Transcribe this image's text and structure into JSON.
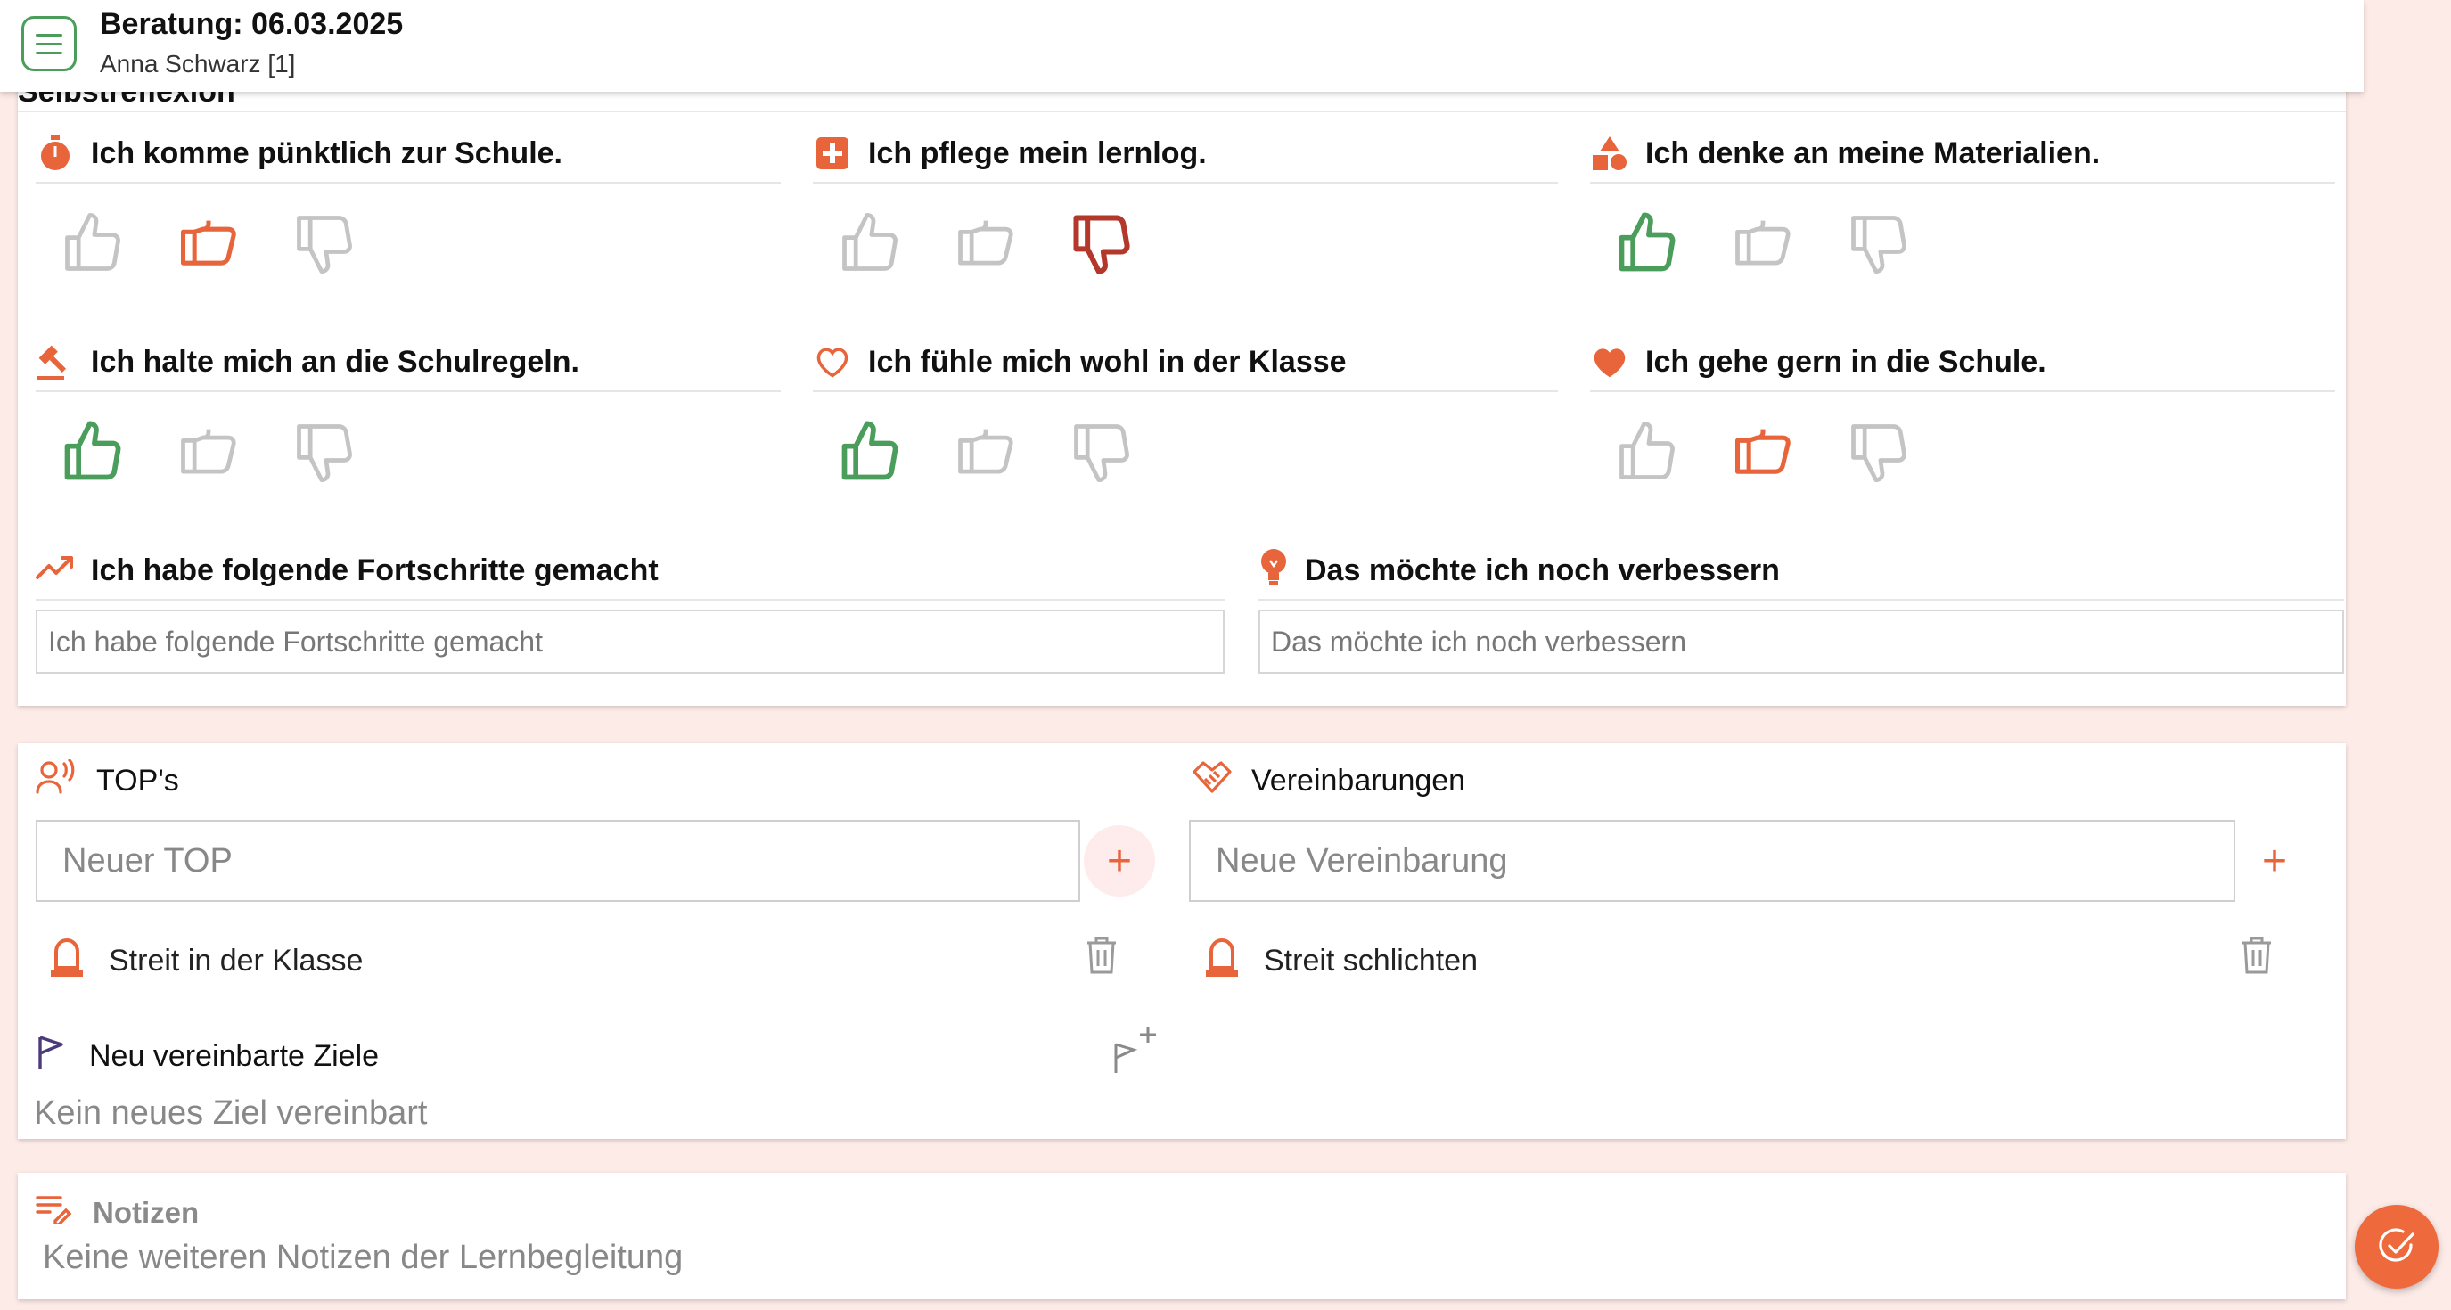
{
  "header": {
    "title": "Beratung: 06.03.2025",
    "subtitle": "Anna Schwarz [1]"
  },
  "self_reflection": {
    "section_title": "Selbstreflexion",
    "items": [
      {
        "label": "Ich komme pünktlich zur Schule.",
        "icon": "stopwatch-icon",
        "selected": "neutral"
      },
      {
        "label": "Ich pflege mein lernlog.",
        "icon": "medical-plus-icon",
        "selected": "down"
      },
      {
        "label": "Ich denke an meine Materialien.",
        "icon": "shapes-icon",
        "selected": "up"
      },
      {
        "label": "Ich halte mich an die Schulregeln.",
        "icon": "gavel-icon",
        "selected": "up"
      },
      {
        "label": "Ich fühle mich wohl in der Klasse",
        "icon": "heart-outline-icon",
        "selected": "up"
      },
      {
        "label": "Ich gehe gern in die Schule.",
        "icon": "heart-icon",
        "selected": "neutral"
      }
    ],
    "progress": {
      "label": "Ich habe folgende Fortschritte gemacht",
      "placeholder": "Ich habe folgende Fortschritte gemacht"
    },
    "improve": {
      "label": "Das möchte ich noch verbessern",
      "placeholder": "Das möchte ich noch verbessern"
    }
  },
  "tops": {
    "title": "TOP's",
    "placeholder": "Neuer TOP",
    "items": [
      "Streit in der Klasse"
    ]
  },
  "agreements": {
    "title": "Vereinbarungen",
    "placeholder": "Neue Vereinbarung",
    "items": [
      "Streit schlichten"
    ]
  },
  "goals": {
    "title": "Neu vereinbarte Ziele",
    "empty": "Kein neues Ziel vereinbart"
  },
  "notes": {
    "title": "Notizen",
    "empty": "Keine weiteren Notizen der Lernbegleitung"
  },
  "colors": {
    "accent": "#e8643a",
    "green": "#4a9d5b",
    "red": "#b3372a",
    "grey": "#c4c4c4"
  }
}
